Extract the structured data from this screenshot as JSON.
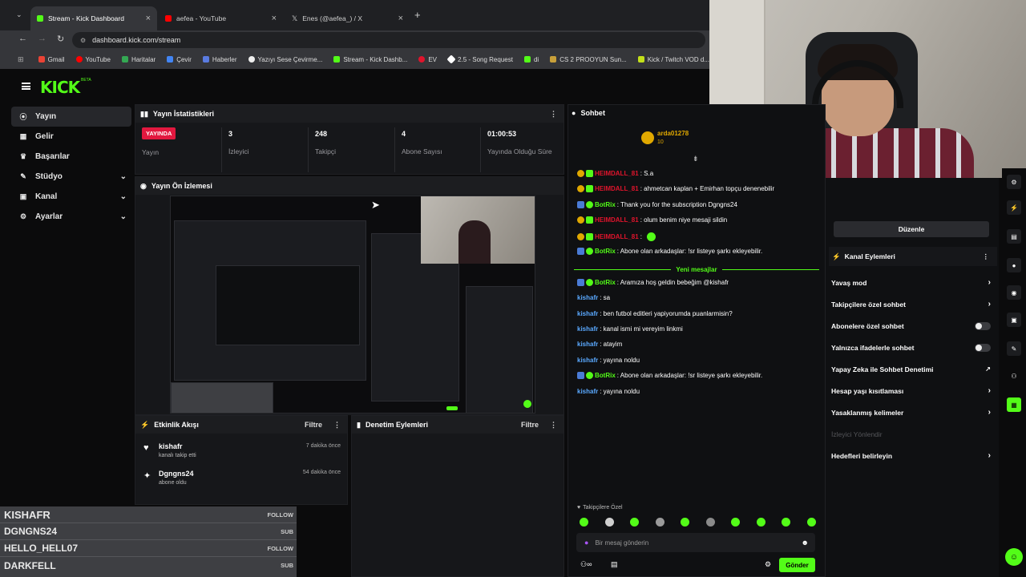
{
  "browser": {
    "tabs": [
      {
        "title": "Stream - Kick Dashboard",
        "active": true
      },
      {
        "title": "aefea - YouTube"
      },
      {
        "title": "Enes (@aefea_) / X"
      }
    ],
    "url": "dashboard.kick.com/stream",
    "bookmarks": [
      "Gmail",
      "YouTube",
      "Haritalar",
      "Çevir",
      "Haberler",
      "Yazıyı Sese Çevirme...",
      "Stream - Kick Dashb...",
      "EV",
      "2.5 - Song Request",
      "di",
      "CS 2 PROOYUN Sun...",
      "Kick / Twitch VOD d..."
    ]
  },
  "kick": {
    "logo": "KICK",
    "beta": "BETA"
  },
  "sidebar": {
    "items": [
      {
        "label": "Yayın",
        "icon": "broadcast-icon",
        "active": true
      },
      {
        "label": "Gelir",
        "icon": "dollar-icon"
      },
      {
        "label": "Başarılar",
        "icon": "trophy-icon"
      },
      {
        "label": "Stüdyo",
        "icon": "studio-icon",
        "chevron": true
      },
      {
        "label": "Kanal",
        "icon": "channel-icon",
        "chevron": true
      },
      {
        "label": "Ayarlar",
        "icon": "gear-icon",
        "chevron": true
      }
    ]
  },
  "stats": {
    "title": "Yayın İstatistikleri",
    "live_badge": "YAYINDA",
    "live_label": "Yayın",
    "items": [
      {
        "value": "3",
        "label": "İzleyici"
      },
      {
        "value": "248",
        "label": "Takipçi"
      },
      {
        "value": "4",
        "label": "Abone Sayısı"
      },
      {
        "value": "01:00:53",
        "label": "Yayında Olduğu Süre"
      }
    ]
  },
  "preview": {
    "title": "Yayın Ön İzlemesi"
  },
  "activity": {
    "title": "Etkinlik Akışı",
    "filter": "Filtre",
    "events": [
      {
        "user": "kishafr",
        "desc": "kanalı takip etti",
        "time": "7 dakika önce"
      },
      {
        "user": "Dgngns24",
        "desc": "abone oldu",
        "time": "54 dakika önce"
      }
    ]
  },
  "moderation": {
    "title": "Denetim Eylemleri",
    "filter": "Filtre"
  },
  "chat": {
    "title": "Sohbet",
    "pinned_user": "arda01278",
    "pinned_level": "10",
    "new_messages": "Yeni mesajlar",
    "messages": [
      {
        "user": "HEIMDALL_81",
        "text": ": S.a",
        "color": "#e0142c"
      },
      {
        "user": "HEIMDALL_81",
        "text": ": ahmetcan kaplan + Emirhan topçu denenebilir",
        "color": "#e0142c"
      },
      {
        "user": "BotRix",
        "text": ": Thank you for the subscription Dgngns24",
        "color": "#53fc18"
      },
      {
        "user": "HEIMDALL_81",
        "text": ": olum benim niye mesaji sildin",
        "color": "#e0142c"
      },
      {
        "user": "HEIMDALL_81",
        "text": ":",
        "color": "#e0142c"
      },
      {
        "user": "BotRix",
        "text": ": Abone olan arkadaşlar: !sr listeye şarkı ekleyebilir.",
        "color": "#53fc18"
      },
      {
        "user": "BotRix",
        "text": ": Aramıza hoş geldin bebeğim @kishafr",
        "color": "#53fc18"
      },
      {
        "user": "kishafr",
        "text": ": sa",
        "color": "#5aa9ff"
      },
      {
        "user": "kishafr",
        "text": ": ben futbol editleri yapiyorumda puanlarmisin?",
        "color": "#5aa9ff"
      },
      {
        "user": "kishafr",
        "text": ": kanal ismi mi vereyim linkmi",
        "color": "#5aa9ff"
      },
      {
        "user": "kishafr",
        "text": ": atayim",
        "color": "#5aa9ff"
      },
      {
        "user": "kishafr",
        "text": ": yayına noldu",
        "color": "#5aa9ff"
      },
      {
        "user": "BotRix",
        "text": ": Abone olan arkadaşlar: !sr listeye şarkı ekleyebilir.",
        "color": "#53fc18"
      },
      {
        "user": "kishafr",
        "text": ": yayına noldu",
        "color": "#5aa9ff"
      }
    ],
    "followers_only": "Takipçilere Özel",
    "input_placeholder": "Bir mesaj gönderin",
    "send": "Gönder"
  },
  "channel_actions": {
    "edit": "Düzenle",
    "title": "Kanal Eylemleri",
    "items": [
      {
        "label": "Yavaş mod",
        "control": "chevron"
      },
      {
        "label": "Takipçilere özel sohbet",
        "control": "chevron"
      },
      {
        "label": "Abonelere özel sohbet",
        "control": "toggle"
      },
      {
        "label": "Yalnızca ifadelerle sohbet",
        "control": "toggle"
      },
      {
        "label": "Yapay Zeka ile Sohbet Denetimi",
        "control": "external"
      },
      {
        "label": "Hesap yaşı kısıtlaması",
        "control": "chevron"
      },
      {
        "label": "Yasaklanmış kelimeler",
        "control": "chevron"
      },
      {
        "label": "İzleyici Yönlendir",
        "control": "none",
        "disabled": true
      },
      {
        "label": "Hedefleri belirleyin",
        "control": "chevron"
      }
    ]
  },
  "follower_overlay": {
    "rows": [
      {
        "name": "KISHAFR",
        "type": "FOLLOW"
      },
      {
        "name": "DGNGNS24",
        "type": "SUB"
      },
      {
        "name": "HELLO_HELL07",
        "type": "FOLLOW"
      },
      {
        "name": "DARKFELL",
        "type": "SUB"
      }
    ]
  }
}
